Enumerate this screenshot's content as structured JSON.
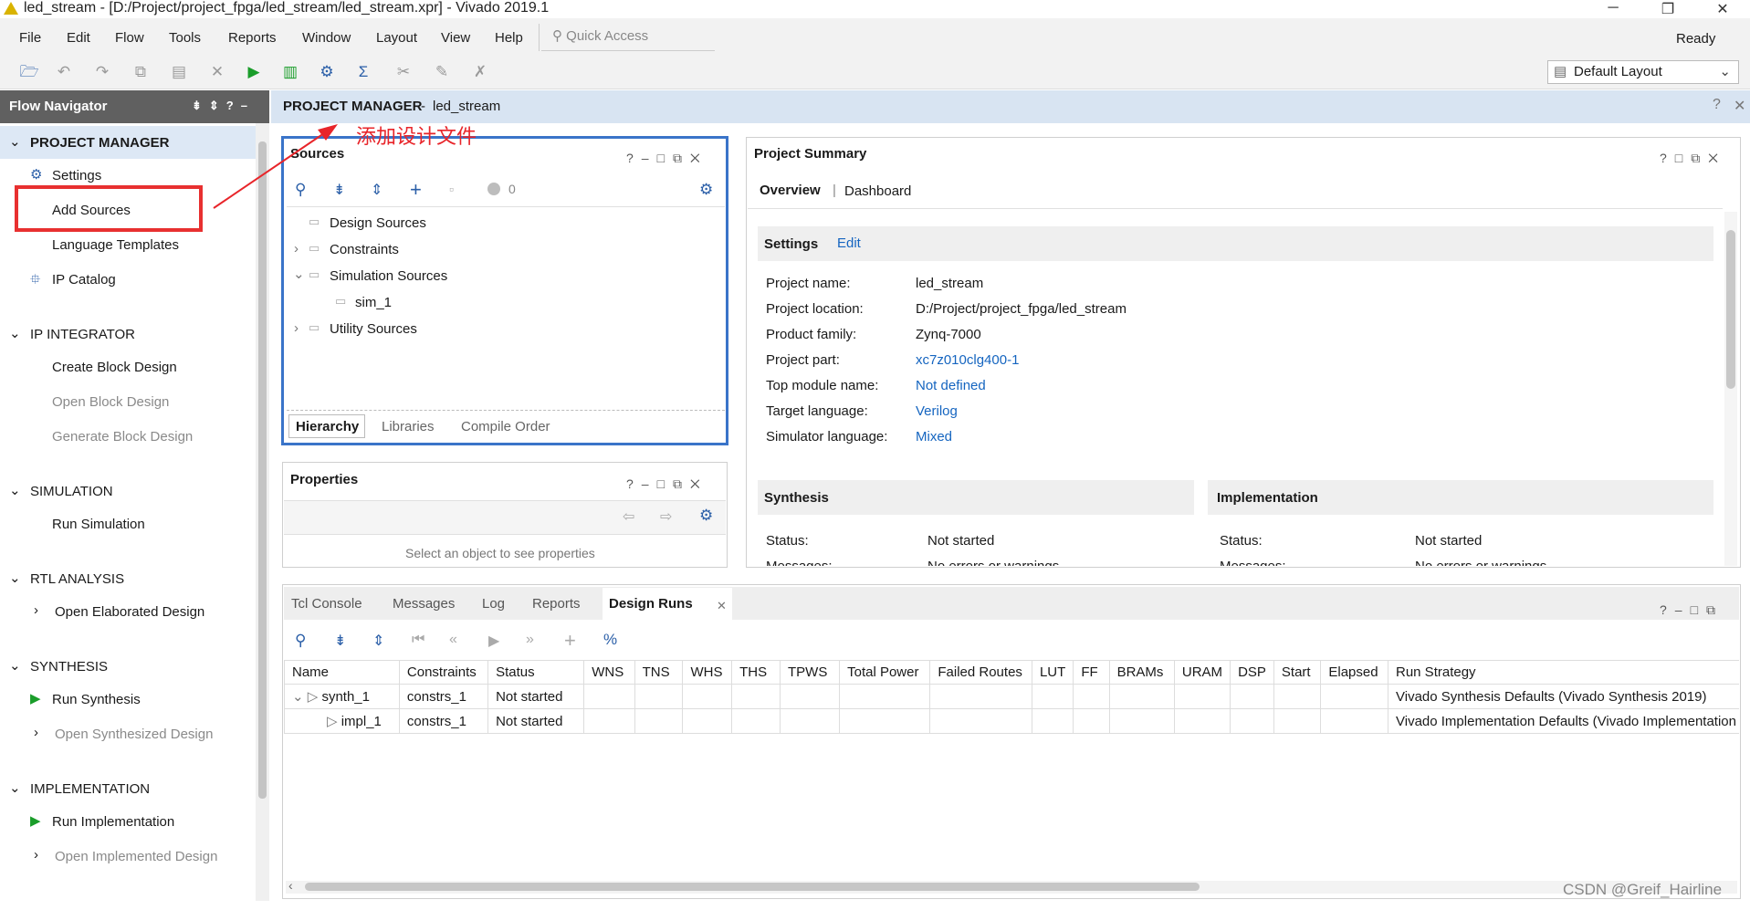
{
  "window": {
    "title": "led_stream - [D:/Project/project_fpga/led_stream/led_stream.xpr] - Vivado 2019.1",
    "status": "Ready"
  },
  "menu": [
    "File",
    "Edit",
    "Flow",
    "Tools",
    "Reports",
    "Window",
    "Layout",
    "View",
    "Help"
  ],
  "quick_access_placeholder": "Quick Access",
  "layout_select": "Default Layout",
  "flow_navigator": {
    "title": "Flow Navigator",
    "sections": [
      {
        "label": "PROJECT MANAGER",
        "items": [
          {
            "label": "Settings",
            "icon": "gear-icon"
          },
          {
            "label": "Add Sources"
          },
          {
            "label": "Language Templates"
          },
          {
            "label": "IP Catalog",
            "icon": "ip-icon"
          }
        ]
      },
      {
        "label": "IP INTEGRATOR",
        "items": [
          {
            "label": "Create Block Design"
          },
          {
            "label": "Open Block Design",
            "disabled": true
          },
          {
            "label": "Generate Block Design",
            "disabled": true
          }
        ]
      },
      {
        "label": "SIMULATION",
        "items": [
          {
            "label": "Run Simulation"
          }
        ]
      },
      {
        "label": "RTL ANALYSIS",
        "items": [
          {
            "label": "Open Elaborated Design"
          }
        ]
      },
      {
        "label": "SYNTHESIS",
        "items": [
          {
            "label": "Run Synthesis",
            "icon": "play-icon"
          },
          {
            "label": "Open Synthesized Design",
            "disabled": true
          }
        ]
      },
      {
        "label": "IMPLEMENTATION",
        "items": [
          {
            "label": "Run Implementation",
            "icon": "play-icon"
          },
          {
            "label": "Open Implemented Design",
            "disabled": true
          }
        ]
      }
    ]
  },
  "project_manager": {
    "title": "PROJECT MANAGER",
    "project": "led_stream"
  },
  "annotation": "添加设计文件",
  "sources": {
    "title": "Sources",
    "count": "0",
    "tree": [
      "Design Sources",
      "Constraints",
      "Simulation Sources",
      "sim_1",
      "Utility Sources"
    ],
    "tabs": [
      "Hierarchy",
      "Libraries",
      "Compile Order"
    ]
  },
  "properties": {
    "title": "Properties",
    "placeholder": "Select an object to see properties"
  },
  "summary": {
    "title": "Project Summary",
    "tabs": [
      "Overview",
      "Dashboard"
    ],
    "settings_label": "Settings",
    "edit_label": "Edit",
    "fields": [
      {
        "label": "Project name:",
        "value": "led_stream",
        "link": false
      },
      {
        "label": "Project location:",
        "value": "D:/Project/project_fpga/led_stream",
        "link": false
      },
      {
        "label": "Product family:",
        "value": "Zynq-7000",
        "link": false
      },
      {
        "label": "Project part:",
        "value": "xc7z010clg400-1",
        "link": true
      },
      {
        "label": "Top module name:",
        "value": "Not defined",
        "link": true
      },
      {
        "label": "Target language:",
        "value": "Verilog",
        "link": true
      },
      {
        "label": "Simulator language:",
        "value": "Mixed",
        "link": true
      }
    ],
    "synthesis": {
      "title": "Synthesis",
      "status_label": "Status:",
      "status": "Not started",
      "messages_label": "Messages:",
      "messages": "No errors or warnings"
    },
    "implementation": {
      "title": "Implementation",
      "status_label": "Status:",
      "status": "Not started",
      "messages_label": "Messages:",
      "messages": "No errors or warnings"
    }
  },
  "bottom": {
    "tabs": [
      "Tcl Console",
      "Messages",
      "Log",
      "Reports",
      "Design Runs"
    ],
    "columns": [
      "Name",
      "Constraints",
      "Status",
      "WNS",
      "TNS",
      "WHS",
      "THS",
      "TPWS",
      "Total Power",
      "Failed Routes",
      "LUT",
      "FF",
      "BRAMs",
      "URAM",
      "DSP",
      "Start",
      "Elapsed",
      "Run Strategy"
    ],
    "rows": [
      {
        "name": "synth_1",
        "constraints": "constrs_1",
        "status": "Not started",
        "strategy": "Vivado Synthesis Defaults (Vivado Synthesis 2019)"
      },
      {
        "name": "impl_1",
        "constraints": "constrs_1",
        "status": "Not started",
        "strategy": "Vivado Implementation Defaults (Vivado Implementation"
      }
    ]
  },
  "watermark": "CSDN @Greif_Hairline",
  "colors": {
    "accent": "#1565c0",
    "annotation": "#e8252a",
    "highlight_blue": "#3a74c9",
    "nav_header": "#606060",
    "pm_header": "#d8e4f2",
    "selected_section": "#dde8f5"
  }
}
